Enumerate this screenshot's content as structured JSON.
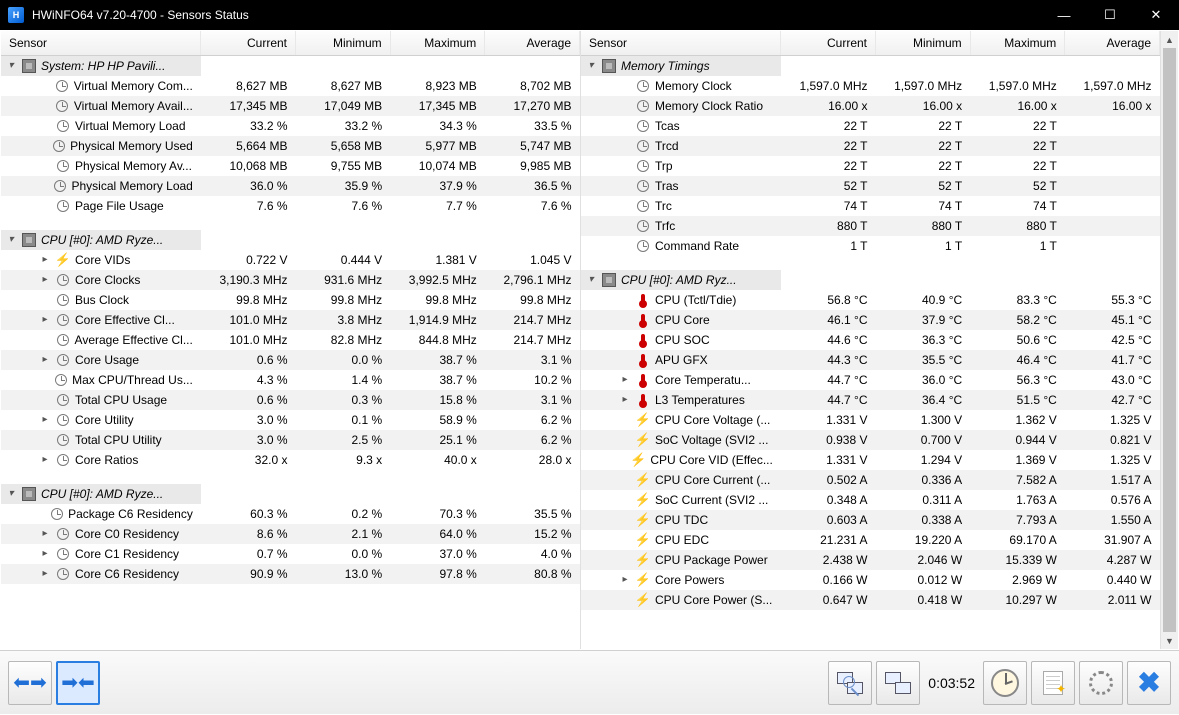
{
  "window": {
    "title": "HWiNFO64 v7.20-4700 - Sensors Status"
  },
  "columns": [
    "Sensor",
    "Current",
    "Minimum",
    "Maximum",
    "Average"
  ],
  "left_pane": [
    {
      "type": "group",
      "icon": "chip",
      "label": "System: HP HP Pavili..."
    },
    {
      "indent": 1,
      "icon": "clock",
      "label": "Virtual Memory Com...",
      "cur": "8,627 MB",
      "min": "8,627 MB",
      "max": "8,923 MB",
      "avg": "8,702 MB"
    },
    {
      "indent": 1,
      "icon": "clock",
      "label": "Virtual Memory Avail...",
      "cur": "17,345 MB",
      "min": "17,049 MB",
      "max": "17,345 MB",
      "avg": "17,270 MB"
    },
    {
      "indent": 1,
      "icon": "clock",
      "label": "Virtual Memory Load",
      "cur": "33.2 %",
      "min": "33.2 %",
      "max": "34.3 %",
      "avg": "33.5 %"
    },
    {
      "indent": 1,
      "icon": "clock",
      "label": "Physical Memory Used",
      "cur": "5,664 MB",
      "min": "5,658 MB",
      "max": "5,977 MB",
      "avg": "5,747 MB"
    },
    {
      "indent": 1,
      "icon": "clock",
      "label": "Physical Memory Av...",
      "cur": "10,068 MB",
      "min": "9,755 MB",
      "max": "10,074 MB",
      "avg": "9,985 MB"
    },
    {
      "indent": 1,
      "icon": "clock",
      "label": "Physical Memory Load",
      "cur": "36.0 %",
      "min": "35.9 %",
      "max": "37.9 %",
      "avg": "36.5 %"
    },
    {
      "indent": 1,
      "icon": "clock",
      "label": "Page File Usage",
      "cur": "7.6 %",
      "min": "7.6 %",
      "max": "7.7 %",
      "avg": "7.6 %"
    },
    {
      "type": "spacer"
    },
    {
      "type": "group",
      "icon": "chip",
      "label": "CPU [#0]: AMD Ryze..."
    },
    {
      "indent": 1,
      "caret": ">",
      "icon": "bolt",
      "label": "Core VIDs",
      "cur": "0.722 V",
      "min": "0.444 V",
      "max": "1.381 V",
      "avg": "1.045 V"
    },
    {
      "indent": 1,
      "caret": ">",
      "icon": "clock",
      "label": "Core Clocks",
      "cur": "3,190.3 MHz",
      "min": "931.6 MHz",
      "max": "3,992.5 MHz",
      "avg": "2,796.1 MHz"
    },
    {
      "indent": 1,
      "icon": "clock",
      "label": "Bus Clock",
      "cur": "99.8 MHz",
      "min": "99.8 MHz",
      "max": "99.8 MHz",
      "avg": "99.8 MHz"
    },
    {
      "indent": 1,
      "caret": ">",
      "icon": "clock",
      "label": "Core Effective Cl...",
      "cur": "101.0 MHz",
      "min": "3.8 MHz",
      "max": "1,914.9 MHz",
      "avg": "214.7 MHz"
    },
    {
      "indent": 1,
      "icon": "clock",
      "label": "Average Effective Cl...",
      "cur": "101.0 MHz",
      "min": "82.8 MHz",
      "max": "844.8 MHz",
      "avg": "214.7 MHz"
    },
    {
      "indent": 1,
      "caret": ">",
      "icon": "clock",
      "label": "Core Usage",
      "cur": "0.6 %",
      "min": "0.0 %",
      "max": "38.7 %",
      "avg": "3.1 %"
    },
    {
      "indent": 1,
      "icon": "clock",
      "label": "Max CPU/Thread Us...",
      "cur": "4.3 %",
      "min": "1.4 %",
      "max": "38.7 %",
      "avg": "10.2 %"
    },
    {
      "indent": 1,
      "icon": "clock",
      "label": "Total CPU Usage",
      "cur": "0.6 %",
      "min": "0.3 %",
      "max": "15.8 %",
      "avg": "3.1 %"
    },
    {
      "indent": 1,
      "caret": ">",
      "icon": "clock",
      "label": "Core Utility",
      "cur": "3.0 %",
      "min": "0.1 %",
      "max": "58.9 %",
      "avg": "6.2 %"
    },
    {
      "indent": 1,
      "icon": "clock",
      "label": "Total CPU Utility",
      "cur": "3.0 %",
      "min": "2.5 %",
      "max": "25.1 %",
      "avg": "6.2 %"
    },
    {
      "indent": 1,
      "caret": ">",
      "icon": "clock",
      "label": "Core Ratios",
      "cur": "32.0 x",
      "min": "9.3 x",
      "max": "40.0 x",
      "avg": "28.0 x"
    },
    {
      "type": "spacer"
    },
    {
      "type": "group",
      "icon": "chip",
      "label": "CPU [#0]: AMD Ryze..."
    },
    {
      "indent": 1,
      "icon": "clock",
      "label": "Package C6 Residency",
      "cur": "60.3 %",
      "min": "0.2 %",
      "max": "70.3 %",
      "avg": "35.5 %"
    },
    {
      "indent": 1,
      "caret": ">",
      "icon": "clock",
      "label": "Core C0 Residency",
      "cur": "8.6 %",
      "min": "2.1 %",
      "max": "64.0 %",
      "avg": "15.2 %"
    },
    {
      "indent": 1,
      "caret": ">",
      "icon": "clock",
      "label": "Core C1 Residency",
      "cur": "0.7 %",
      "min": "0.0 %",
      "max": "37.0 %",
      "avg": "4.0 %"
    },
    {
      "indent": 1,
      "caret": ">",
      "icon": "clock",
      "label": "Core C6 Residency",
      "cur": "90.9 %",
      "min": "13.0 %",
      "max": "97.8 %",
      "avg": "80.8 %"
    }
  ],
  "right_pane": [
    {
      "type": "group",
      "icon": "chip",
      "label": "Memory Timings"
    },
    {
      "indent": 1,
      "icon": "clock",
      "label": "Memory Clock",
      "cur": "1,597.0 MHz",
      "min": "1,597.0 MHz",
      "max": "1,597.0 MHz",
      "avg": "1,597.0 MHz"
    },
    {
      "indent": 1,
      "icon": "clock",
      "label": "Memory Clock Ratio",
      "cur": "16.00 x",
      "min": "16.00 x",
      "max": "16.00 x",
      "avg": "16.00 x"
    },
    {
      "indent": 1,
      "icon": "clock",
      "label": "Tcas",
      "cur": "22 T",
      "min": "22 T",
      "max": "22 T",
      "avg": ""
    },
    {
      "indent": 1,
      "icon": "clock",
      "label": "Trcd",
      "cur": "22 T",
      "min": "22 T",
      "max": "22 T",
      "avg": ""
    },
    {
      "indent": 1,
      "icon": "clock",
      "label": "Trp",
      "cur": "22 T",
      "min": "22 T",
      "max": "22 T",
      "avg": ""
    },
    {
      "indent": 1,
      "icon": "clock",
      "label": "Tras",
      "cur": "52 T",
      "min": "52 T",
      "max": "52 T",
      "avg": ""
    },
    {
      "indent": 1,
      "icon": "clock",
      "label": "Trc",
      "cur": "74 T",
      "min": "74 T",
      "max": "74 T",
      "avg": ""
    },
    {
      "indent": 1,
      "icon": "clock",
      "label": "Trfc",
      "cur": "880 T",
      "min": "880 T",
      "max": "880 T",
      "avg": ""
    },
    {
      "indent": 1,
      "icon": "clock",
      "label": "Command Rate",
      "cur": "1 T",
      "min": "1 T",
      "max": "1 T",
      "avg": ""
    },
    {
      "type": "spacer"
    },
    {
      "type": "group",
      "icon": "chip",
      "label": "CPU [#0]: AMD Ryz..."
    },
    {
      "indent": 1,
      "icon": "therm",
      "label": "CPU (Tctl/Tdie)",
      "cur": "56.8 °C",
      "min": "40.9 °C",
      "max": "83.3 °C",
      "avg": "55.3 °C"
    },
    {
      "indent": 1,
      "icon": "therm",
      "label": "CPU Core",
      "cur": "46.1 °C",
      "min": "37.9 °C",
      "max": "58.2 °C",
      "avg": "45.1 °C"
    },
    {
      "indent": 1,
      "icon": "therm",
      "label": "CPU SOC",
      "cur": "44.6 °C",
      "min": "36.3 °C",
      "max": "50.6 °C",
      "avg": "42.5 °C"
    },
    {
      "indent": 1,
      "icon": "therm",
      "label": "APU GFX",
      "cur": "44.3 °C",
      "min": "35.5 °C",
      "max": "46.4 °C",
      "avg": "41.7 °C"
    },
    {
      "indent": 1,
      "caret": ">",
      "icon": "therm",
      "label": "Core Temperatu...",
      "cur": "44.7 °C",
      "min": "36.0 °C",
      "max": "56.3 °C",
      "avg": "43.0 °C"
    },
    {
      "indent": 1,
      "caret": ">",
      "icon": "therm",
      "label": "L3 Temperatures",
      "cur": "44.7 °C",
      "min": "36.4 °C",
      "max": "51.5 °C",
      "avg": "42.7 °C"
    },
    {
      "indent": 1,
      "icon": "bolt",
      "label": "CPU Core Voltage (...",
      "cur": "1.331 V",
      "min": "1.300 V",
      "max": "1.362 V",
      "avg": "1.325 V"
    },
    {
      "indent": 1,
      "icon": "bolt",
      "label": "SoC Voltage (SVI2 ...",
      "cur": "0.938 V",
      "min": "0.700 V",
      "max": "0.944 V",
      "avg": "0.821 V"
    },
    {
      "indent": 1,
      "icon": "bolt",
      "label": "CPU Core VID (Effec...",
      "cur": "1.331 V",
      "min": "1.294 V",
      "max": "1.369 V",
      "avg": "1.325 V"
    },
    {
      "indent": 1,
      "icon": "bolt",
      "label": "CPU Core Current (...",
      "cur": "0.502 A",
      "min": "0.336 A",
      "max": "7.582 A",
      "avg": "1.517 A"
    },
    {
      "indent": 1,
      "icon": "bolt",
      "label": "SoC Current (SVI2 ...",
      "cur": "0.348 A",
      "min": "0.311 A",
      "max": "1.763 A",
      "avg": "0.576 A"
    },
    {
      "indent": 1,
      "icon": "bolt",
      "label": "CPU TDC",
      "cur": "0.603 A",
      "min": "0.338 A",
      "max": "7.793 A",
      "avg": "1.550 A"
    },
    {
      "indent": 1,
      "icon": "bolt",
      "label": "CPU EDC",
      "cur": "21.231 A",
      "min": "19.220 A",
      "max": "69.170 A",
      "avg": "31.907 A"
    },
    {
      "indent": 1,
      "icon": "bolt",
      "label": "CPU Package Power",
      "cur": "2.438 W",
      "min": "2.046 W",
      "max": "15.339 W",
      "avg": "4.287 W"
    },
    {
      "indent": 1,
      "caret": ">",
      "icon": "bolt",
      "label": "Core Powers",
      "cur": "0.166 W",
      "min": "0.012 W",
      "max": "2.969 W",
      "avg": "0.440 W"
    },
    {
      "indent": 1,
      "icon": "bolt",
      "label": "CPU Core Power (S...",
      "cur": "0.647 W",
      "min": "0.418 W",
      "max": "10.297 W",
      "avg": "2.011 W"
    }
  ],
  "bottom": {
    "elapsed": "0:03:52"
  }
}
